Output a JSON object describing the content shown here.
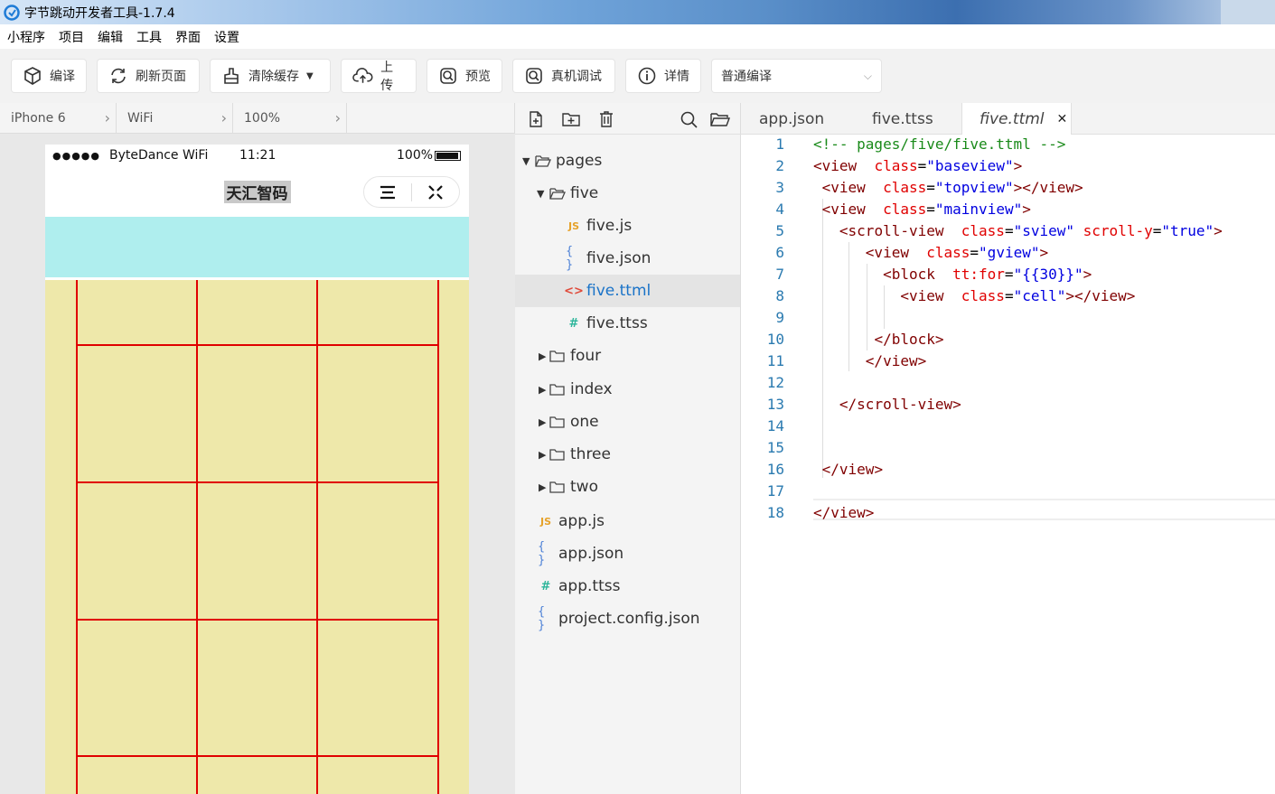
{
  "window": {
    "title": "字节跳动开发者工具-1.7.4"
  },
  "menu": [
    "小程序",
    "项目",
    "编辑",
    "工具",
    "界面",
    "设置"
  ],
  "toolbar": {
    "compile": "编译",
    "refresh": "刷新页面",
    "clear_cache": "清除缓存",
    "upload": "上传",
    "preview": "预览",
    "remote_debug": "真机调试",
    "details": "详情",
    "compile_mode": "普通编译"
  },
  "simulator": {
    "device": "iPhone 6",
    "network": "WiFi",
    "zoom": "100%",
    "status": {
      "dots": "●●●●●",
      "carrier": "ByteDance WiFi",
      "time": "11:21",
      "battery": "100%"
    },
    "nav_title": "天汇智码",
    "colors": {
      "topview": "#afeeee",
      "mainview": "#eee8aa",
      "grid": "#e00000"
    }
  },
  "tree": [
    {
      "label": "pages",
      "type": "folder",
      "expanded": true
    },
    {
      "label": "five",
      "type": "folder",
      "expanded": true
    },
    {
      "label": "five.js",
      "type": "js"
    },
    {
      "label": "five.json",
      "type": "json"
    },
    {
      "label": "five.ttml",
      "type": "ttml",
      "selected": true
    },
    {
      "label": "five.ttss",
      "type": "ttss"
    },
    {
      "label": "four",
      "type": "folder"
    },
    {
      "label": "index",
      "type": "folder"
    },
    {
      "label": "one",
      "type": "folder"
    },
    {
      "label": "three",
      "type": "folder"
    },
    {
      "label": "two",
      "type": "folder"
    },
    {
      "label": "app.js",
      "type": "js"
    },
    {
      "label": "app.json",
      "type": "json"
    },
    {
      "label": "app.ttss",
      "type": "ttss"
    },
    {
      "label": "project.config.json",
      "type": "json"
    }
  ],
  "editor": {
    "tabs": [
      "app.json",
      "five.ttss",
      "five.ttml"
    ],
    "close_glyph": "✕",
    "lines": [
      {
        "n": "1",
        "tokens": [
          [
            "c",
            "<!-- pages/five/five.ttml -->"
          ]
        ]
      },
      {
        "n": "2",
        "tokens": [
          [
            "tag",
            "<view"
          ],
          [
            "plain",
            "  "
          ],
          [
            "attr",
            "class"
          ],
          [
            "plain",
            "="
          ],
          [
            "str",
            "\"baseview\""
          ],
          [
            "tag",
            ">"
          ]
        ]
      },
      {
        "n": "3",
        "tokens": [
          [
            "plain",
            " "
          ],
          [
            "tag",
            "<view"
          ],
          [
            "plain",
            "  "
          ],
          [
            "attr",
            "class"
          ],
          [
            "plain",
            "="
          ],
          [
            "str",
            "\"topview\""
          ],
          [
            "tag",
            "></view>"
          ]
        ]
      },
      {
        "n": "4",
        "tokens": [
          [
            "plain",
            " "
          ],
          [
            "tag",
            "<view"
          ],
          [
            "plain",
            "  "
          ],
          [
            "attr",
            "class"
          ],
          [
            "plain",
            "="
          ],
          [
            "str",
            "\"mainview\""
          ],
          [
            "tag",
            ">"
          ]
        ]
      },
      {
        "n": "5",
        "tokens": [
          [
            "plain",
            "   "
          ],
          [
            "tag",
            "<scroll-view"
          ],
          [
            "plain",
            "  "
          ],
          [
            "attr",
            "class"
          ],
          [
            "plain",
            "="
          ],
          [
            "str",
            "\"sview\""
          ],
          [
            "plain",
            " "
          ],
          [
            "attr",
            "scroll-y"
          ],
          [
            "plain",
            "="
          ],
          [
            "str",
            "\"true\""
          ],
          [
            "tag",
            ">"
          ]
        ]
      },
      {
        "n": "6",
        "tokens": [
          [
            "plain",
            "      "
          ],
          [
            "tag",
            "<view"
          ],
          [
            "plain",
            "  "
          ],
          [
            "attr",
            "class"
          ],
          [
            "plain",
            "="
          ],
          [
            "str",
            "\"gview\""
          ],
          [
            "tag",
            ">"
          ]
        ]
      },
      {
        "n": "7",
        "tokens": [
          [
            "plain",
            "        "
          ],
          [
            "tag",
            "<block"
          ],
          [
            "plain",
            "  "
          ],
          [
            "attr",
            "tt:for"
          ],
          [
            "plain",
            "="
          ],
          [
            "str",
            "\"{{30}}\""
          ],
          [
            "tag",
            ">"
          ]
        ]
      },
      {
        "n": "8",
        "tokens": [
          [
            "plain",
            "          "
          ],
          [
            "tag",
            "<view"
          ],
          [
            "plain",
            "  "
          ],
          [
            "attr",
            "class"
          ],
          [
            "plain",
            "="
          ],
          [
            "str",
            "\"cell\""
          ],
          [
            "tag",
            "></view>"
          ]
        ]
      },
      {
        "n": "9",
        "tokens": []
      },
      {
        "n": "10",
        "tokens": [
          [
            "plain",
            "       "
          ],
          [
            "tag",
            "</block>"
          ]
        ]
      },
      {
        "n": "11",
        "tokens": [
          [
            "plain",
            "      "
          ],
          [
            "tag",
            "</view>"
          ]
        ]
      },
      {
        "n": "12",
        "tokens": []
      },
      {
        "n": "13",
        "tokens": [
          [
            "plain",
            "   "
          ],
          [
            "tag",
            "</scroll-view>"
          ]
        ]
      },
      {
        "n": "14",
        "tokens": []
      },
      {
        "n": "15",
        "tokens": []
      },
      {
        "n": "16",
        "tokens": [
          [
            "plain",
            " "
          ],
          [
            "tag",
            "</view>"
          ]
        ]
      },
      {
        "n": "17",
        "tokens": []
      },
      {
        "n": "18",
        "tokens": [
          [
            "tag",
            "</view>"
          ]
        ]
      }
    ]
  }
}
